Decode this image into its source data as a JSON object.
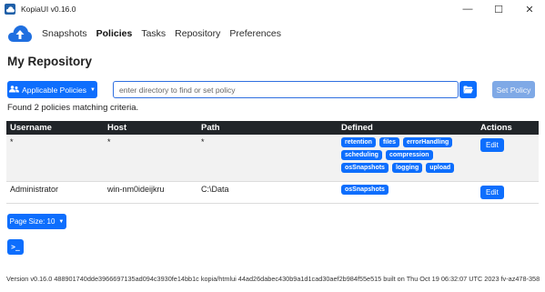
{
  "window": {
    "title": "KopiaUI v0.16.0",
    "minimize": "—",
    "maximize": "☐",
    "close": "✕"
  },
  "nav": {
    "items": [
      "Snapshots",
      "Policies",
      "Tasks",
      "Repository",
      "Preferences"
    ],
    "active": "Policies"
  },
  "page": {
    "title": "My Repository"
  },
  "toolbar": {
    "policies_button": "Applicable Policies",
    "search_placeholder": "enter directory to find or set policy",
    "search_value": "",
    "set_policy_button": "Set Policy"
  },
  "status": {
    "found": "Found 2 policies matching criteria."
  },
  "table": {
    "headers": [
      "Username",
      "Host",
      "Path",
      "Defined",
      "Actions"
    ],
    "rows": [
      {
        "username": "*",
        "host": "*",
        "path": "*",
        "defined": [
          "retention",
          "files",
          "errorHandling",
          "scheduling",
          "compression",
          "osSnapshots",
          "logging",
          "upload"
        ],
        "action": "Edit"
      },
      {
        "username": "Administrator",
        "host": "win-nm0ideijkru",
        "path": "C:\\Data",
        "defined": [
          "osSnapshots"
        ],
        "action": "Edit"
      }
    ]
  },
  "footer": {
    "page_size": "Page Size: 10",
    "terminal_button": ">_",
    "version": "Version v0.16.0 488901740dde3966697135ad094c3930fe14bb1c kopia/htmlui 44ad26dabec430b9a1d1cad30aef2b984f55e515 built on Thu Oct 19 06:32:07 UTC 2023 fv-az478-358"
  },
  "colors": {
    "primary": "#0d6efd",
    "primary_disabled": "#7fa9e6",
    "table_header": "#212529",
    "logo": "#1f6fe0"
  }
}
